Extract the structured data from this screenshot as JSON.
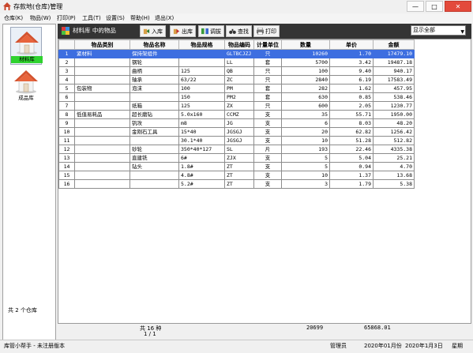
{
  "window": {
    "title": "存款地(仓库)管理",
    "min_label": "—",
    "max_label": "□",
    "close_label": "✕"
  },
  "menu": [
    {
      "label": "仓库(K)"
    },
    {
      "label": "物品(W)"
    },
    {
      "label": "打印(P)"
    },
    {
      "label": "工具(T)"
    },
    {
      "label": "设置(S)"
    },
    {
      "label": "帮助(H)"
    },
    {
      "label": "退出(X)"
    }
  ],
  "sidebar": {
    "items": [
      {
        "label": "材料库",
        "icon": "house-icon",
        "selected": true
      },
      {
        "label": "成品库",
        "icon": "house-icon",
        "selected": false
      }
    ],
    "count_text": "共 2 个仓库"
  },
  "toolbar": {
    "title": "材料库 中的物品",
    "buttons": [
      {
        "label": "入库",
        "icon": "stock-in-icon"
      },
      {
        "label": "出库",
        "icon": "stock-out-icon"
      },
      {
        "label": "调拔",
        "icon": "transfer-icon"
      },
      {
        "label": "查找",
        "icon": "binoculars-icon"
      },
      {
        "label": "打印",
        "icon": "printer-icon"
      }
    ],
    "filter": {
      "value": "显示全部"
    }
  },
  "table": {
    "columns": [
      "",
      "物品类别",
      "物品名称",
      "物品规格",
      "物品编码",
      "计量单位",
      "数量",
      "单价",
      "金额"
    ],
    "rows": [
      {
        "idx": "1",
        "category": "紧材料",
        "name": "保持架组件",
        "spec": "",
        "code": "GLTBCJZJ",
        "unit": "只",
        "qty": "10260",
        "price": "1.70",
        "amount": "17479.10",
        "selected": true
      },
      {
        "idx": "2",
        "category": "",
        "name": "钢轮",
        "spec": "",
        "code": "LL",
        "unit": "套",
        "qty": "5700",
        "price": "3.42",
        "amount": "19487.18"
      },
      {
        "idx": "3",
        "category": "",
        "name": "曲柄",
        "spec": "125",
        "code": "QB",
        "unit": "只",
        "qty": "100",
        "price": "9.40",
        "amount": "940.17"
      },
      {
        "idx": "4",
        "category": "",
        "name": "轴承",
        "spec": "63/22",
        "code": "ZC",
        "unit": "只",
        "qty": "2840",
        "price": "6.19",
        "amount": "17583.49"
      },
      {
        "idx": "5",
        "category": "包装物",
        "name": "泡沫",
        "spec": "100",
        "code": "PM",
        "unit": "套",
        "qty": "282",
        "price": "1.62",
        "amount": "457.95"
      },
      {
        "idx": "6",
        "category": "",
        "name": "",
        "spec": "150",
        "code": "PM2",
        "unit": "套",
        "qty": "630",
        "price": "0.85",
        "amount": "538.46"
      },
      {
        "idx": "7",
        "category": "",
        "name": "纸箱",
        "spec": "125",
        "code": "ZX",
        "unit": "只",
        "qty": "600",
        "price": "2.05",
        "amount": "1230.77"
      },
      {
        "idx": "8",
        "category": "低值易耗品",
        "name": "超长磨钻",
        "spec": "5.0x160",
        "code": "CCMZ",
        "unit": "支",
        "qty": "35",
        "price": "55.71",
        "amount": "1950.00"
      },
      {
        "idx": "9",
        "category": "",
        "name": "钒攻",
        "spec": "m8",
        "code": "JG",
        "unit": "支",
        "qty": "6",
        "price": "8.03",
        "amount": "48.20"
      },
      {
        "idx": "10",
        "category": "",
        "name": "金刚石工具",
        "spec": "15*40",
        "code": "JGSGJ",
        "unit": "支",
        "qty": "20",
        "price": "62.82",
        "amount": "1256.42"
      },
      {
        "idx": "11",
        "category": "",
        "name": "",
        "spec": "30.1*40",
        "code": "JGSGJ",
        "unit": "支",
        "qty": "10",
        "price": "51.28",
        "amount": "512.82"
      },
      {
        "idx": "12",
        "category": "",
        "name": "砂轮",
        "spec": "350*40*127",
        "code": "SL",
        "unit": "片",
        "qty": "193",
        "price": "22.46",
        "amount": "4335.38"
      },
      {
        "idx": "13",
        "category": "",
        "name": "直建铣",
        "spec": "6#",
        "code": "ZJX",
        "unit": "支",
        "qty": "5",
        "price": "5.04",
        "amount": "25.21"
      },
      {
        "idx": "14",
        "category": "",
        "name": "钻头",
        "spec": "1.8#",
        "code": "ZT",
        "unit": "支",
        "qty": "5",
        "price": "0.94",
        "amount": "4.70"
      },
      {
        "idx": "15",
        "category": "",
        "name": "",
        "spec": "4.8#",
        "code": "ZT",
        "unit": "支",
        "qty": "10",
        "price": "1.37",
        "amount": "13.68"
      },
      {
        "idx": "16",
        "category": "",
        "name": "",
        "spec": "5.2#",
        "code": "ZT",
        "unit": "支",
        "qty": "3",
        "price": "1.79",
        "amount": "5.38"
      }
    ],
    "footer": {
      "count_text": "共 16 种",
      "page_text": "1 / 1",
      "qty_total": "20699",
      "amount_total": "65868.01"
    }
  },
  "status": {
    "left": "库管小帮手 - 未注册版本",
    "user": "管理员",
    "month": "2020年01月份",
    "date": "2020年1月3日",
    "weekday": "星期"
  },
  "colors": {
    "selection": "#3d6ee0",
    "sidebar_selected": "#2fd22f",
    "toolbar_bg": "#343434",
    "close_button": "#e34a3b"
  }
}
